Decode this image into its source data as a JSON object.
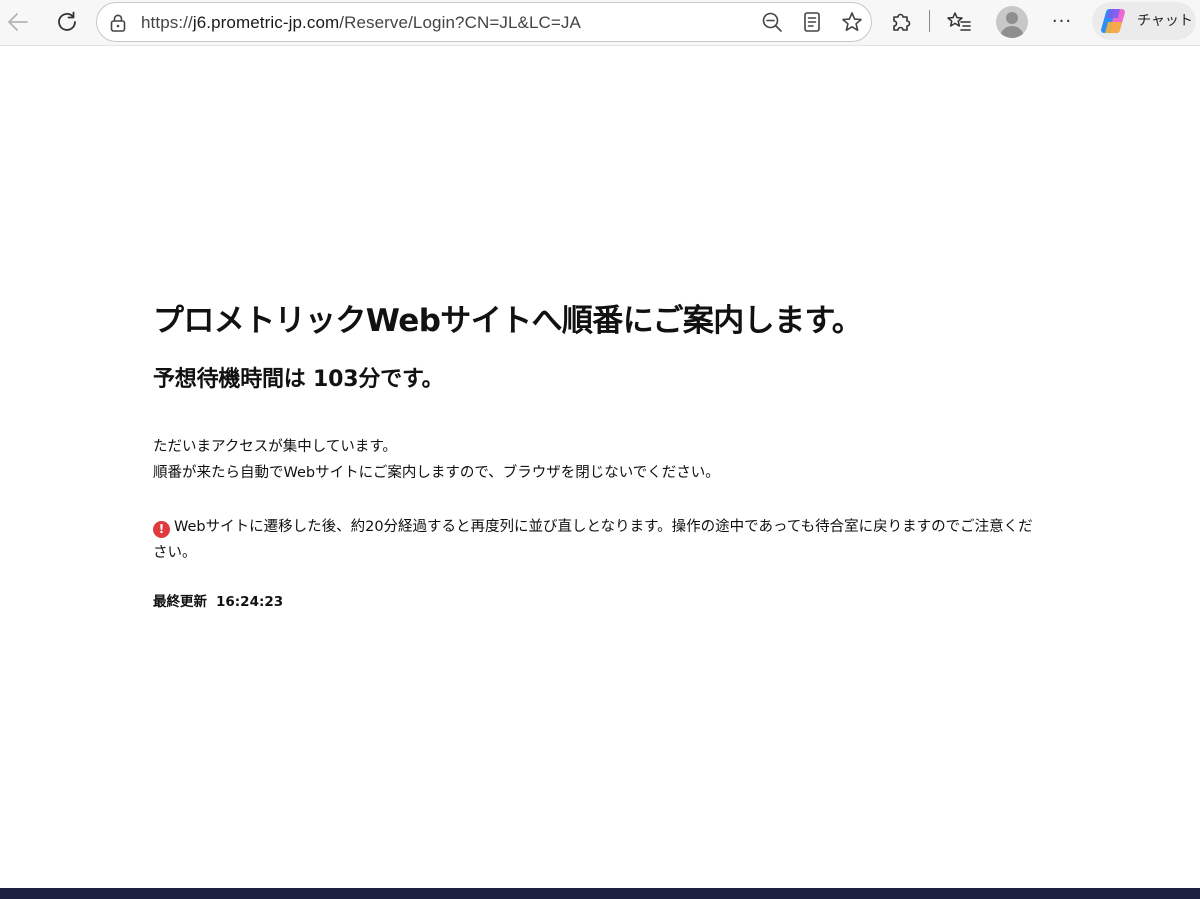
{
  "browser": {
    "url_prefix": "https://",
    "url_host": "j6.prometric-jp.com",
    "url_path": "/Reserve/Login?CN=JL&LC=JA",
    "chat_label": "チャット",
    "more_label": "···",
    "icons": {
      "back": "back-arrow-icon",
      "refresh": "refresh-icon",
      "lock": "lock-icon",
      "zoom": "zoom-out-icon",
      "reader": "reading-view-icon",
      "favorite": "star-icon",
      "extensions": "puzzle-icon",
      "favorites_list": "favorites-list-icon",
      "profile": "profile-avatar-icon",
      "copilot": "copilot-icon"
    }
  },
  "page": {
    "title": "プロメトリックWebサイトへ順番にご案内します。",
    "wait_time": "予想待機時間は 103分です。",
    "info_line1": "ただいまアクセスが集中しています。",
    "info_line2": "順番が来たら自動でWebサイトにご案内しますので、ブラウザを閉じないでください。",
    "warning_icon": "!",
    "warning_text": "Webサイトに遷移した後、約20分経過すると再度列に並び直しとなります。操作の途中であっても待合室に戻りますのでご注意ください。",
    "last_updated_label": "最終更新",
    "last_updated_time": "16:24:23"
  },
  "colors": {
    "warning": "#e0393e",
    "bottom_bar": "#1c2140"
  }
}
